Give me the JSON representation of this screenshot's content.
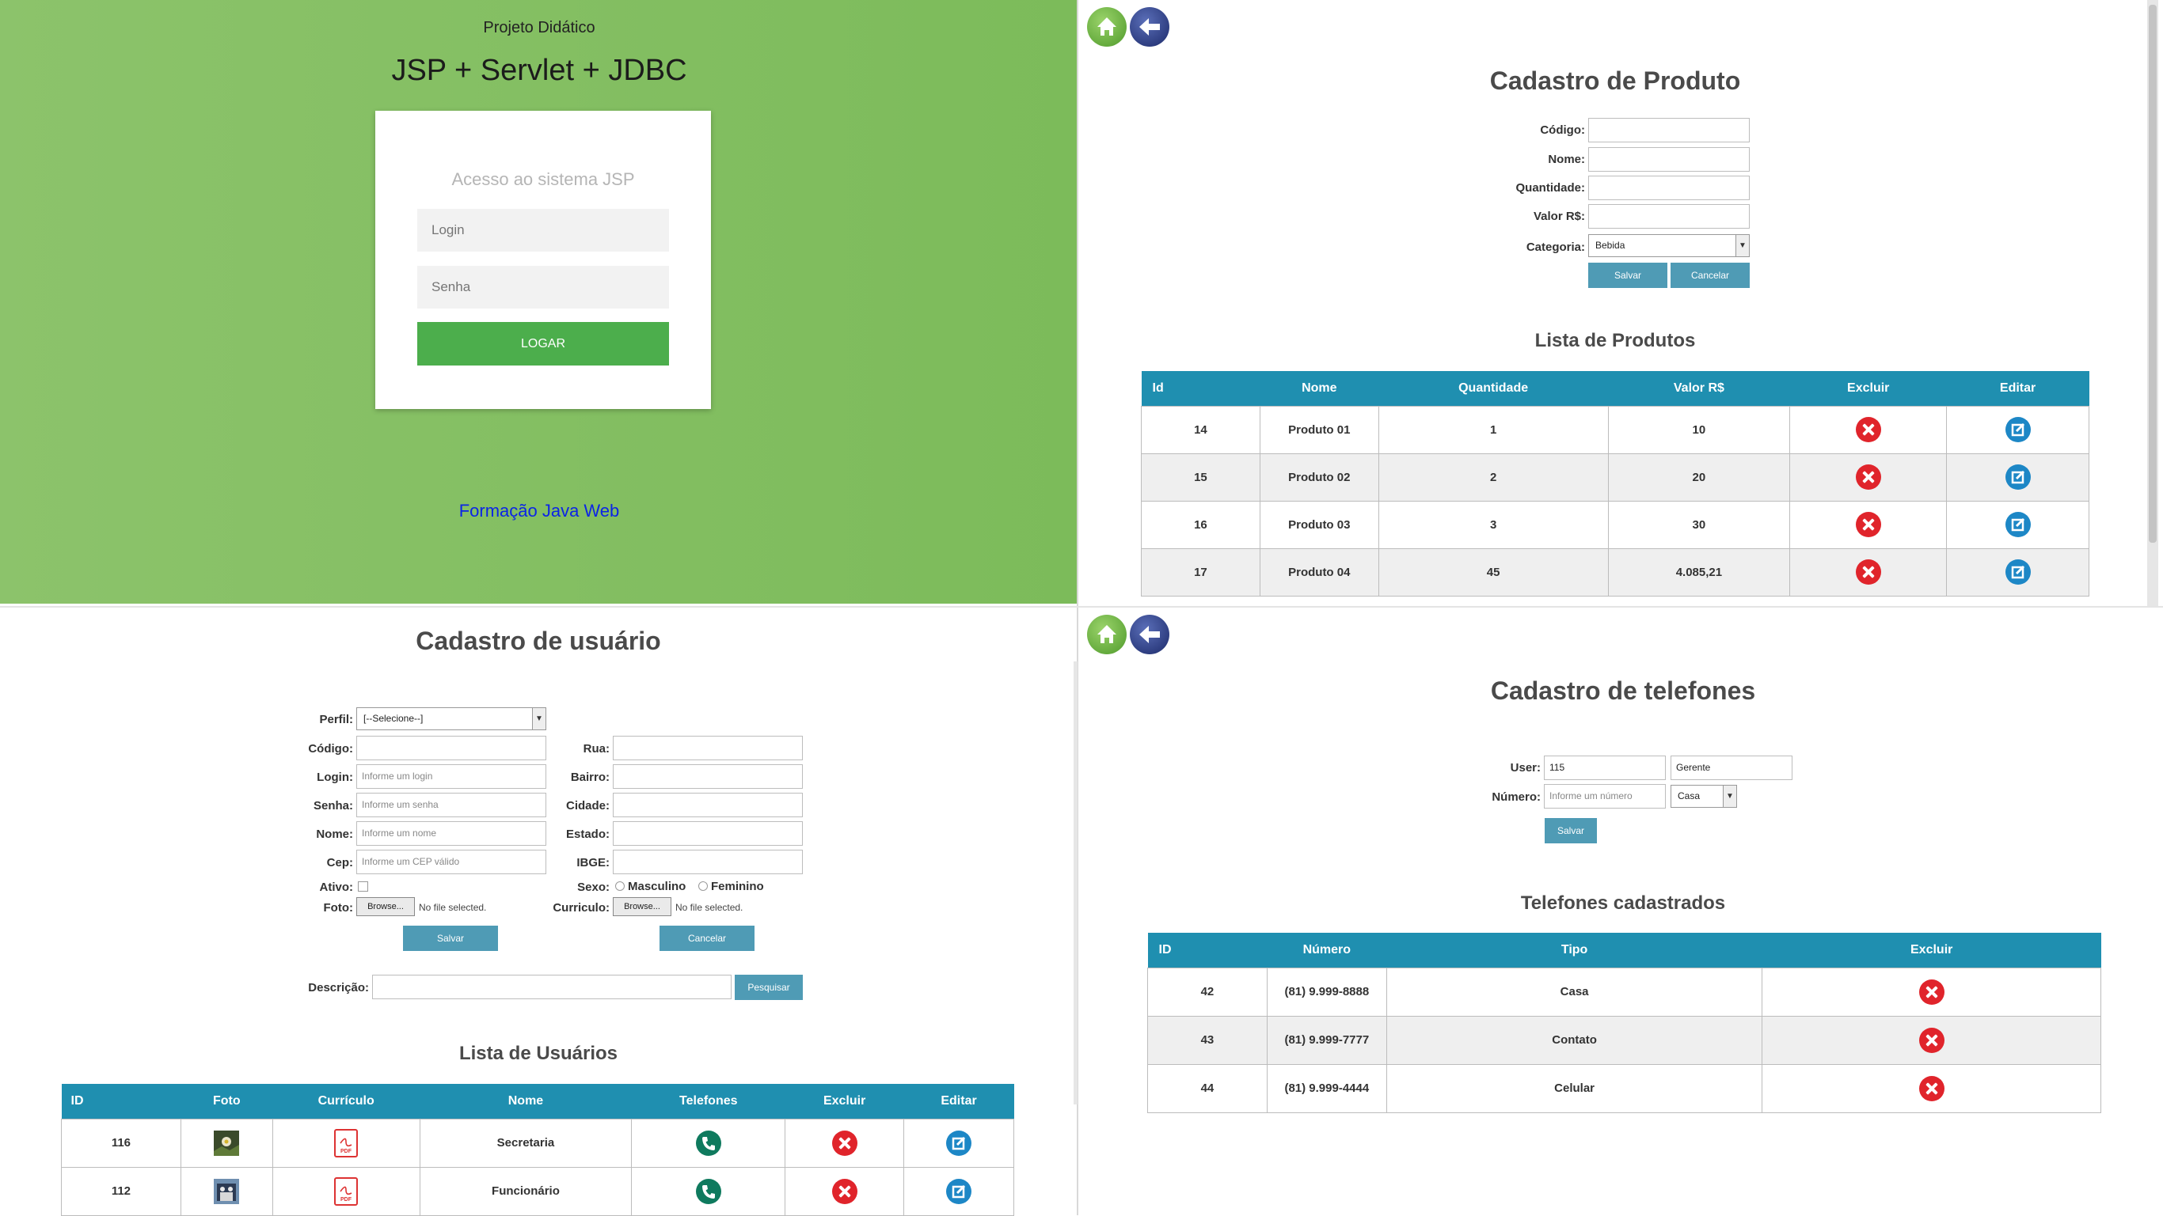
{
  "login": {
    "project": "Projeto Didático",
    "title": "JSP + Servlet + JDBC",
    "card_title": "Acesso ao sistema JSP",
    "login_placeholder": "Login",
    "password_placeholder": "Senha",
    "submit_label": "LOGAR",
    "link_text": "Formação Java Web",
    "bg_color": "#7cbb5a",
    "button_color": "#4cae4c"
  },
  "produto": {
    "title": "Cadastro de Produto",
    "labels": {
      "codigo": "Código:",
      "nome": "Nome:",
      "quantidade": "Quantidade:",
      "valor": "Valor R$:",
      "categoria": "Categoria:"
    },
    "categoria_value": "Bebida",
    "save_label": "Salvar",
    "cancel_label": "Cancelar",
    "list_title": "Lista de Produtos",
    "columns": [
      "Id",
      "Nome",
      "Quantidade",
      "Valor R$",
      "Excluir",
      "Editar"
    ],
    "rows": [
      {
        "id": "14",
        "nome": "Produto 01",
        "quantidade": "1",
        "valor": "10"
      },
      {
        "id": "15",
        "nome": "Produto 02",
        "quantidade": "2",
        "valor": "20"
      },
      {
        "id": "16",
        "nome": "Produto 03",
        "quantidade": "3",
        "valor": "30"
      },
      {
        "id": "17",
        "nome": "Produto 04",
        "quantidade": "45",
        "valor": "4.085,21"
      }
    ]
  },
  "usuario": {
    "title": "Cadastro de usuário",
    "labels": {
      "perfil": "Perfil:",
      "codigo": "Código:",
      "login": "Login:",
      "senha": "Senha:",
      "nome": "Nome:",
      "cep": "Cep:",
      "ativo": "Ativo:",
      "foto": "Foto:",
      "rua": "Rua:",
      "bairro": "Bairro:",
      "cidade": "Cidade:",
      "estado": "Estado:",
      "ibge": "IBGE:",
      "sexo": "Sexo:",
      "curriculo": "Curriculo:",
      "descricao": "Descrição:"
    },
    "perfil_value": "[--Selecione--]",
    "placeholders": {
      "login": "Informe um login",
      "senha": "Informe um senha",
      "nome": "Informe um nome",
      "cep": "Informe um CEP válido"
    },
    "sexo_options": [
      "Masculino",
      "Feminino"
    ],
    "browse_label": "Browse...",
    "no_file": "No file selected.",
    "save_label": "Salvar",
    "cancel_label": "Cancelar",
    "search_label": "Pesquisar",
    "list_title": "Lista de Usuários",
    "columns": [
      "ID",
      "Foto",
      "Currículo",
      "Nome",
      "Telefones",
      "Excluir",
      "Editar"
    ],
    "rows": [
      {
        "id": "116",
        "nome": "Secretaria"
      },
      {
        "id": "112",
        "nome": "Funcionário"
      }
    ]
  },
  "telefones": {
    "title": "Cadastro de telefones",
    "labels": {
      "user": "User:",
      "numero": "Número:"
    },
    "user_id": "115",
    "user_name": "Gerente",
    "numero_placeholder": "Informe um número",
    "tipo_value": "Casa",
    "save_label": "Salvar",
    "list_title": "Telefones cadastrados",
    "columns": [
      "ID",
      "Número",
      "Tipo",
      "Excluir"
    ],
    "rows": [
      {
        "id": "42",
        "numero": "(81) 9.999-8888",
        "tipo": "Casa"
      },
      {
        "id": "43",
        "numero": "(81) 9.999-7777",
        "tipo": "Contato"
      },
      {
        "id": "44",
        "numero": "(81) 9.999-4444",
        "tipo": "Celular"
      }
    ]
  },
  "icons": {
    "home": "home-icon",
    "back": "back-arrow-icon",
    "delete": "delete-icon",
    "edit": "edit-icon",
    "phone": "phone-icon",
    "pdf": "pdf-icon"
  },
  "colors": {
    "table_header": "#1f8fb0",
    "button": "#4f9bb5",
    "delete": "#e0242b",
    "edit": "#1d87c6"
  }
}
